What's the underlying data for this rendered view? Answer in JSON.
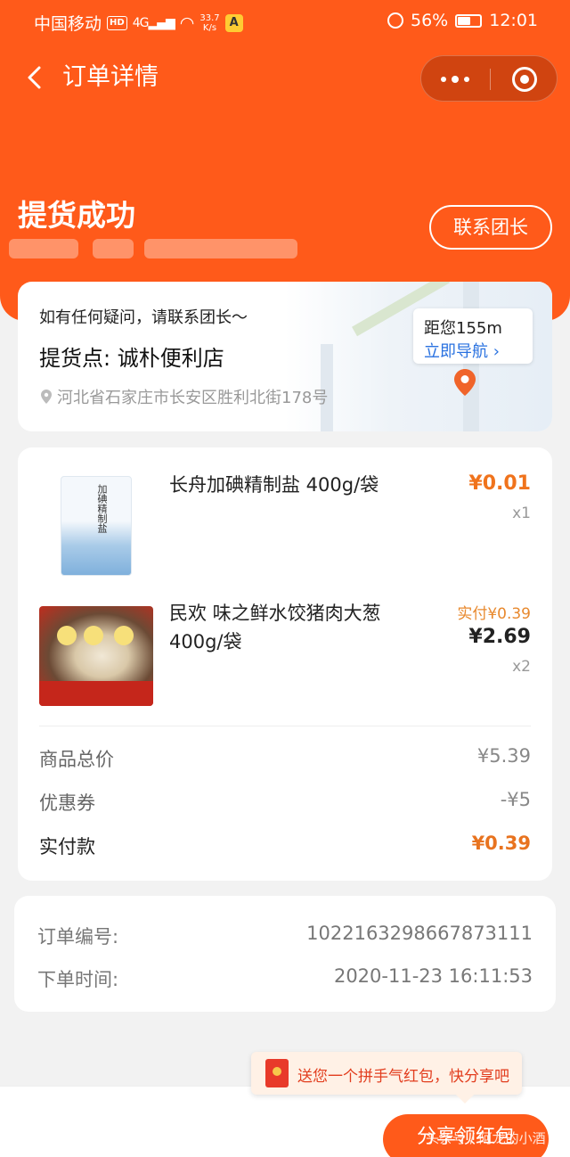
{
  "status_bar": {
    "carrier": "中国移动",
    "hd": "HD",
    "network": "4G",
    "speed_value": "33.7",
    "speed_unit": "K/s",
    "app_letter": "A",
    "battery": "56%",
    "battery_level": 0.56,
    "time": "12:01"
  },
  "header": {
    "title": "订单详情",
    "status": "提货成功",
    "contact_button": "联系团长"
  },
  "pickup": {
    "hint": "如有任何疑问，请联系团长～",
    "point": "提货点: 诚朴便利店",
    "address": "河北省石家庄市长安区胜利北街178号",
    "distance": "距您155m",
    "navigate": "立即导航",
    "nav_chevron": "›"
  },
  "products": [
    {
      "name": "长舟加碘精制盐 400g/袋",
      "image_text": "加碘精制盐",
      "price": "¥0.01",
      "qty": "x1"
    },
    {
      "name": "民欢 味之鲜水饺猪肉大葱400g/袋",
      "paid": "实付¥0.39",
      "price": "¥2.69",
      "qty": "x2"
    }
  ],
  "summary": {
    "total_label": "商品总价",
    "total_value": "¥5.39",
    "coupon_label": "优惠券",
    "coupon_value": "-¥5",
    "paid_label": "实付款",
    "paid_value": "¥0.39"
  },
  "order": {
    "number_label": "订单编号:",
    "number_value": "1022163298667873111",
    "time_label": "下单时间:",
    "time_value": "2020-11-23 16:11:53"
  },
  "share": {
    "tip": "送您一个拼手气红包，快分享吧",
    "button": "分享领红包",
    "watermark": "头条号 / 阿龙的小酒"
  },
  "colors": {
    "brand": "#ff5a1a",
    "price": "#f0731c",
    "link": "#2a72e0"
  }
}
